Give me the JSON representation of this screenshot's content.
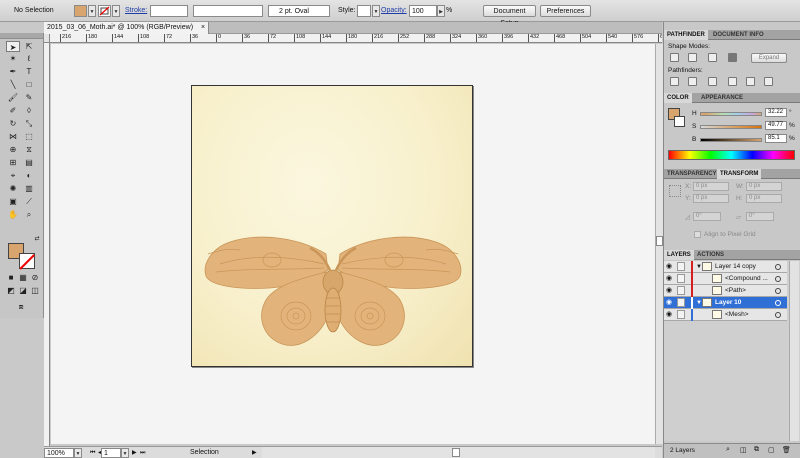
{
  "control_bar": {
    "selection_status": "No Selection",
    "stroke_label": "Stroke:",
    "brush_label": "2 pt. Oval",
    "style_label": "Style:",
    "opacity_label": "Opacity:",
    "opacity_value": "100",
    "opacity_unit": "%",
    "document_setup_label": "Document Setup",
    "preferences_label": "Preferences",
    "fill_color": "#d8a56e"
  },
  "document_tab": {
    "title": "2015_03_06_Moth.ai* @ 100% (RGB/Preview)",
    "close_glyph": "×"
  },
  "ruler_top": [
    "216",
    "180",
    "144",
    "108",
    "72",
    "36",
    "0",
    "36",
    "72",
    "108",
    "144",
    "180",
    "216",
    "252",
    "288",
    "324",
    "360",
    "396",
    "432",
    "468",
    "504",
    "540",
    "576",
    "612"
  ],
  "status_bar": {
    "zoom": "100%",
    "artboard": "1",
    "tool_name": "Selection"
  },
  "pathfinder_panel": {
    "tabs": [
      "PATHFINDER",
      "DOCUMENT INFO"
    ],
    "shape_modes_label": "Shape Modes:",
    "expand_label": "Expand",
    "pathfinders_label": "Pathfinders:"
  },
  "color_panel": {
    "tabs": [
      "COLOR",
      "APPEARANCE"
    ],
    "channels": [
      {
        "label": "H",
        "value": "32.22",
        "level_percent": 9
      },
      {
        "label": "S",
        "value": "49.77",
        "level_percent": 50
      },
      {
        "label": "B",
        "value": "85.1",
        "level_percent": 85
      }
    ],
    "fill_color": "#d8a56e"
  },
  "transform_panel": {
    "tabs": [
      "TRANSPARENCY",
      "TRANSFORM"
    ],
    "x_label": "X:",
    "x_value": "0 px",
    "y_label": "Y:",
    "y_value": "0 px",
    "w_label": "W:",
    "w_value": "0 px",
    "h_label": "H:",
    "h_value": "0 px",
    "rotate_value": "0°",
    "shear_value": "0°",
    "align_label": "Align to Pixel Grid"
  },
  "layers_panel": {
    "tabs": [
      "LAYERS",
      "ACTIONS"
    ],
    "rows": [
      {
        "name": "Layer 14 copy",
        "level": 0,
        "selected": false,
        "color": "#d62020"
      },
      {
        "name": "<Compound ...",
        "level": 1,
        "selected": false,
        "color": "#d62020"
      },
      {
        "name": "<Path>",
        "level": 1,
        "selected": false,
        "color": "#d62020"
      },
      {
        "name": "Layer 10",
        "level": 0,
        "selected": true,
        "color": "#2f6fd6"
      },
      {
        "name": "<Mesh>",
        "level": 1,
        "selected": false,
        "color": "#2f6fd6"
      }
    ],
    "layer_count": "2 Layers"
  }
}
